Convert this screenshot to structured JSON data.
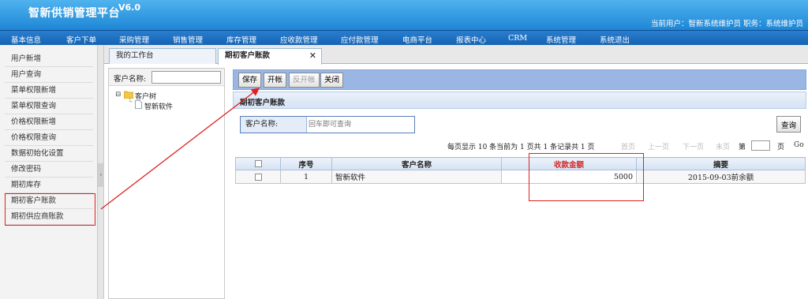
{
  "header": {
    "title": "智新供销管理平台",
    "version": "V6.0",
    "user_info": "当前用户：智新系统维护员 职务：系统维护员"
  },
  "nav": {
    "items": [
      "基本信息",
      "客户下单",
      "采购管理",
      "销售管理",
      "库存管理",
      "应收款管理",
      "应付款管理",
      "电商平台",
      "报表中心",
      "CRM",
      "系统管理",
      "系统退出"
    ]
  },
  "sidebar": {
    "items": [
      "用户新增",
      "用户查询",
      "菜单权限新增",
      "菜单权限查询",
      "价格权限新增",
      "价格权限查询",
      "数据初始化设置",
      "修改密码",
      "期初库存",
      "期初客户账款",
      "期初供应商账款"
    ]
  },
  "tabs": {
    "workbench": "我的工作台",
    "active": "期初客户账款",
    "close_glyph": "✕"
  },
  "tree": {
    "search_label": "客户名称:",
    "root": "客户树",
    "child": "智新软件",
    "expander": "⊟"
  },
  "toolbar": {
    "save": "保存",
    "open": "开帐",
    "reverse": "反开帐",
    "close": "关闭"
  },
  "panel": {
    "title": "期初客户账款",
    "search_label": "客户名称:",
    "search_placeholder": "回车即可查询",
    "query_button": "查询"
  },
  "pager": {
    "summary": "每页显示 10 条当前为 1 页共 1 条记录共 1 页",
    "first": "首页",
    "prev": "上一页",
    "next": "下一页",
    "last": "末页",
    "page_prefix": "第",
    "page_suffix": "页",
    "go": "Go"
  },
  "table": {
    "headers": [
      "",
      "序号",
      "客户名称",
      "收款金额",
      "摘要"
    ],
    "rows": [
      {
        "index": "1",
        "customer": "智新软件",
        "amount": "5000",
        "summary": "2015-09-03前余额"
      }
    ]
  },
  "colors": {
    "header_blue": "#1e86d5",
    "nav_blue": "#1462b3",
    "toolbar_blue": "#9ab6e3",
    "highlight_red": "#e02020"
  }
}
